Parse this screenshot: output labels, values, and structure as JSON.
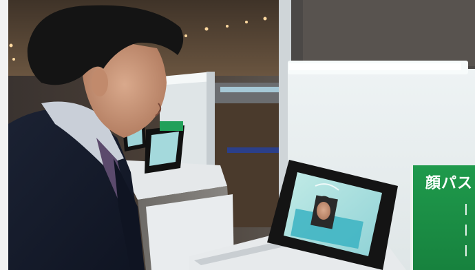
{
  "scene": {
    "sign": {
      "text": "顔パス",
      "color": "#1c8f47"
    },
    "tablet_screen_color": "#a9dfe0",
    "left_bar_color": "#f2f2f2"
  }
}
